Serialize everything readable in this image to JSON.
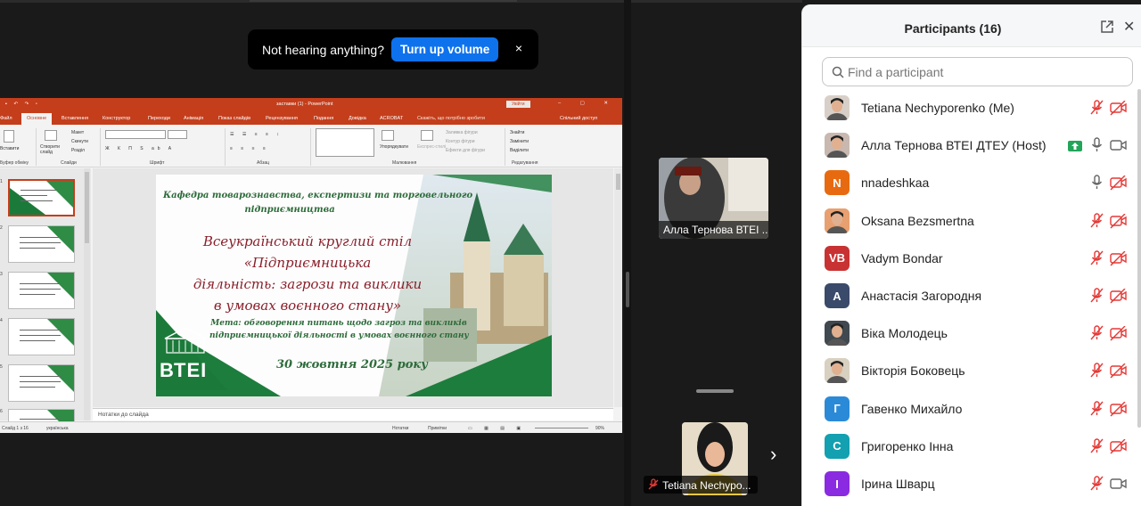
{
  "toast": {
    "message": "Not hearing anything?",
    "action": "Turn up volume",
    "close": "×"
  },
  "ppt": {
    "window_title": "заставки (1) - PowerPoint",
    "sign_in": "Увійти",
    "menu": [
      "Файл",
      "Основне",
      "Вставлення",
      "Конструктор",
      "Переходи",
      "Анімація",
      "Показ слайдів",
      "Рецензування",
      "Подання",
      "Довідка",
      "ACROBAT",
      "Скажіть, що потрібно зробити",
      "Спільний доступ"
    ],
    "ribbon": {
      "clipboard": "Буфер обміну",
      "slides": "Слайди",
      "font": "Шрифт",
      "paragraph": "Абзац",
      "drawing": "Малювання",
      "editing": "Редагування",
      "new_slide": "Створити слайд",
      "paste": "Вставити",
      "layout": "Макет",
      "reset": "Скинути",
      "section": "Розділ",
      "arrange": "Упорядкувати",
      "quick_styles": "Експрес-стилі",
      "shape_fill": "Заливка фігури",
      "shape_outline": "Контур фігури",
      "shape_effects": "Ефекти для фігури",
      "find": "Знайти",
      "replace": "Замінити",
      "select": "Виділити"
    },
    "notes_placeholder": "Нотатки до слайда",
    "status": {
      "slide": "Слайд 1 з 16",
      "lang": "українська",
      "notes": "Нотатки",
      "comments": "Примітки",
      "zoom": "90%"
    },
    "thumb_numbers": [
      "1",
      "2",
      "3",
      "4",
      "5",
      "6"
    ],
    "slide": {
      "dept_line1": "Кафедра товарознавства, експертизи та торговельного",
      "dept_line2": "підприємництва",
      "title1": "Всеукраїнський круглий стіл",
      "title2": "«Підприємницька",
      "title3": "діяльність: загрози та виклики",
      "title4": "в умовах воєнного стану»",
      "goal1": "Мета: обговорення питань щодо загроз та викликів",
      "goal2": "підприємницької діяльності в умовах воєнного стану",
      "date": "30 жовтня 2025 року",
      "logo": "ВТЕІ"
    }
  },
  "tiles": {
    "host_label": "Алла Тернова ВТЕІ ...",
    "self_label": "Tetiana Nechypo..."
  },
  "panel": {
    "title": "Participants (16)",
    "search_placeholder": "Find a participant",
    "participants": [
      {
        "name": "Tetiana Nechyporenko (Me)",
        "initials": "",
        "color": "#d8d0c8",
        "mic": "muted",
        "cam": "off"
      },
      {
        "name": "Алла Тернова ВТЕІ ДТЕУ (Host)",
        "initials": "",
        "color": "#c8b8b0",
        "mic": "on",
        "cam": "on",
        "sharing": true
      },
      {
        "name": "nnadeshkaa",
        "initials": "N",
        "color": "#e86a10",
        "mic": "on",
        "cam": "off"
      },
      {
        "name": "Oksana Bezsmertna",
        "initials": "",
        "color": "#e8a070",
        "mic": "muted",
        "cam": "off"
      },
      {
        "name": "Vadym Bondar",
        "initials": "VB",
        "color": "#c83232",
        "mic": "muted",
        "cam": "off"
      },
      {
        "name": "Анастасія Загородня",
        "initials": "A",
        "color": "#3a4a6a",
        "mic": "muted",
        "cam": "off"
      },
      {
        "name": "Віка Молодець",
        "initials": "",
        "color": "#404850",
        "mic": "muted",
        "cam": "off"
      },
      {
        "name": "Вікторія Боковець",
        "initials": "",
        "color": "#d8d0c0",
        "mic": "muted",
        "cam": "off"
      },
      {
        "name": "Гавенко Михайло",
        "initials": "Г",
        "color": "#2b8ad8",
        "mic": "muted",
        "cam": "off"
      },
      {
        "name": "Григоренко Інна",
        "initials": "С",
        "color": "#13a0b0",
        "mic": "muted",
        "cam": "off"
      },
      {
        "name": "Ірина Шварц",
        "initials": "І",
        "color": "#8a2be2",
        "mic": "muted",
        "cam": "on"
      }
    ]
  }
}
